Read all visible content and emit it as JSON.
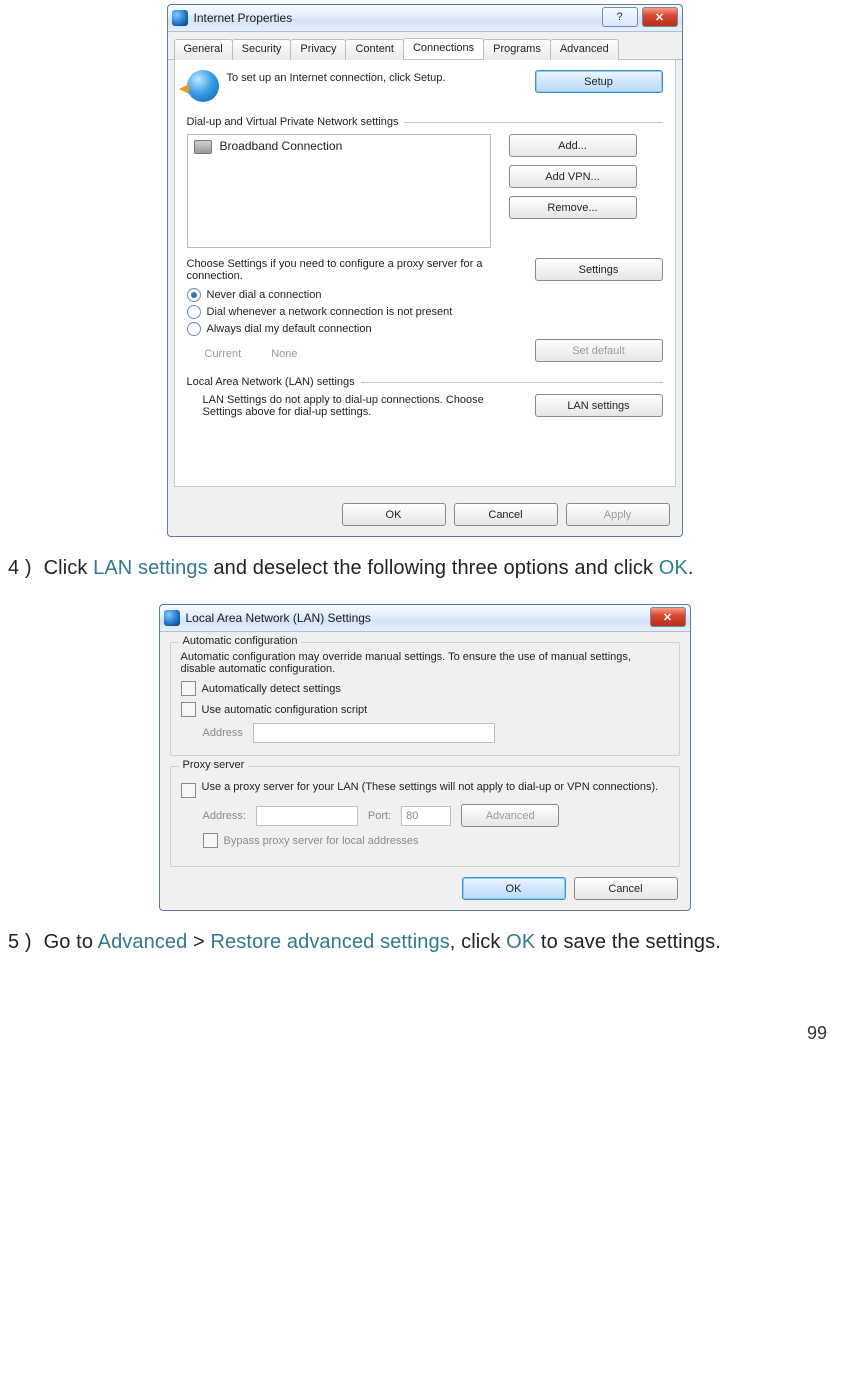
{
  "page_number": "99",
  "step4": {
    "num": "4 )",
    "prefix": "Click ",
    "hl1": "LAN settings",
    "mid": " and deselect the following three options and click ",
    "hl2": "OK",
    "suffix": "."
  },
  "step5": {
    "num": "5 )",
    "prefix": "Go to ",
    "hl1": "Advanced",
    "sep": " > ",
    "hl2": "Restore advanced settings",
    "mid": ", click ",
    "hl3": "OK",
    "suffix": " to save the settings."
  },
  "ipwin": {
    "title": "Internet Properties",
    "help": "?",
    "close": "✕",
    "tabs": {
      "general": "General",
      "security": "Security",
      "privacy": "Privacy",
      "content": "Content",
      "connections": "Connections",
      "programs": "Programs",
      "advanced": "Advanced"
    },
    "intro_text": "To set up an Internet connection, click Setup.",
    "setup_btn": "Setup",
    "sect_dialup": "Dial-up and Virtual Private Network settings",
    "list_item": "Broadband Connection",
    "add_btn": "Add...",
    "addvpn_btn": "Add VPN...",
    "remove_btn": "Remove...",
    "choose_text": "Choose Settings if you need to configure a proxy server for a connection.",
    "settings_btn": "Settings",
    "radio1": "Never dial a connection",
    "radio2": "Dial whenever a network connection is not present",
    "radio3": "Always dial my default connection",
    "current_lbl": "Current",
    "current_val": "None",
    "setdefault_btn": "Set default",
    "sect_lan": "Local Area Network (LAN) settings",
    "lan_text": "LAN Settings do not apply to dial-up connections. Choose Settings above for dial-up settings.",
    "lan_btn": "LAN settings",
    "ok_btn": "OK",
    "cancel_btn": "Cancel",
    "apply_btn": "Apply"
  },
  "lanwin": {
    "title": "Local Area Network (LAN) Settings",
    "close": "✕",
    "grp_auto": "Automatic configuration",
    "auto_text": "Automatic configuration may override manual settings.  To ensure the use of manual settings, disable automatic configuration.",
    "chk_auto_detect": "Automatically detect settings",
    "chk_auto_script": "Use automatic configuration script",
    "address_lbl": "Address",
    "grp_proxy": "Proxy server",
    "proxy_text": "Use a proxy server for your LAN (These settings will not apply to dial-up or VPN connections).",
    "addr2_lbl": "Address:",
    "port_lbl": "Port:",
    "port_val": "80",
    "adv_btn": "Advanced",
    "bypass": "Bypass proxy server for local addresses",
    "ok_btn": "OK",
    "cancel_btn": "Cancel"
  }
}
